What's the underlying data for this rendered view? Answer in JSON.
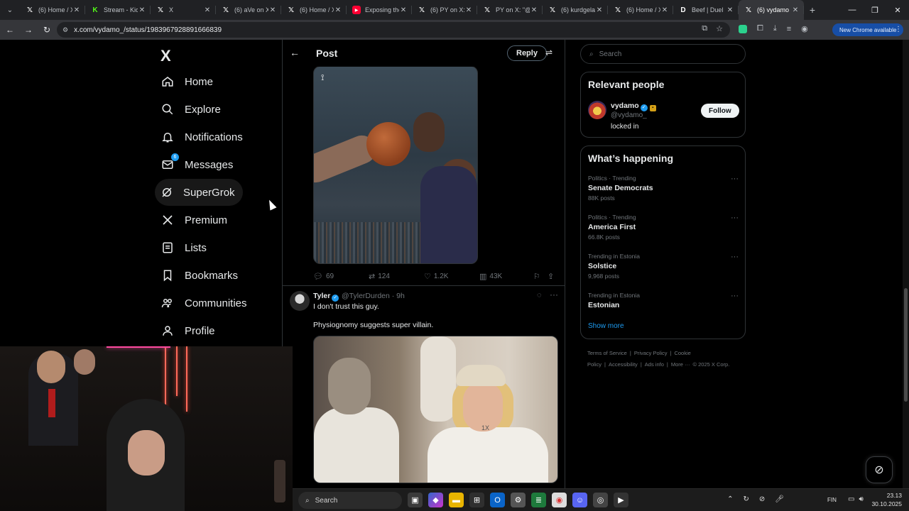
{
  "browser": {
    "tabs": [
      {
        "favicon": "x-icon",
        "title": "(6) Home / X",
        "active": false
      },
      {
        "favicon": "kick-icon",
        "title": "Stream - Kick",
        "active": false
      },
      {
        "favicon": "x-icon",
        "title": "X",
        "active": false
      },
      {
        "favicon": "x-icon",
        "title": "(6) aVe on X:",
        "active": false
      },
      {
        "favicon": "x-icon",
        "title": "(6) Home / X",
        "active": false
      },
      {
        "favicon": "youtube-icon",
        "title": "Exposing the",
        "active": false
      },
      {
        "favicon": "x-icon",
        "title": "(6) PY on X:",
        "active": false
      },
      {
        "favicon": "x-icon",
        "title": "PY on X: \"@",
        "active": false
      },
      {
        "favicon": "x-icon",
        "title": "(6) kurdgela",
        "active": false
      },
      {
        "favicon": "x-icon",
        "title": "(6) Home / X",
        "active": false
      },
      {
        "favicon": "d-icon",
        "title": "Beef | Duel",
        "active": false
      },
      {
        "favicon": "x-icon",
        "title": "(6) vydamo",
        "active": true
      }
    ],
    "url": "x.com/vydamo_/status/1983967928891666839",
    "new_chrome_label": "New Chrome available"
  },
  "nav": {
    "logo": "X",
    "items": [
      {
        "label": "Home",
        "icon": "home-icon"
      },
      {
        "label": "Explore",
        "icon": "search-icon"
      },
      {
        "label": "Notifications",
        "icon": "bell-icon"
      },
      {
        "label": "Messages",
        "icon": "mail-icon",
        "badge": "6"
      },
      {
        "label": "SuperGrok",
        "icon": "grok-icon"
      },
      {
        "label": "Premium",
        "icon": "x-premium-icon"
      },
      {
        "label": "Lists",
        "icon": "list-icon"
      },
      {
        "label": "Bookmarks",
        "icon": "bookmark-icon"
      },
      {
        "label": "Communities",
        "icon": "communities-icon"
      },
      {
        "label": "Profile",
        "icon": "profile-icon"
      }
    ]
  },
  "post": {
    "header_title": "Post",
    "reply_button": "Reply",
    "stats": {
      "replies": "69",
      "reposts": "124",
      "likes": "1.2K",
      "views": "43K"
    }
  },
  "reply": {
    "name": "Tyler",
    "handle": "@TylerDurden · 9h",
    "line1": "I don't trust this guy.",
    "line2": "Physiognomy suggests super villain."
  },
  "sidebar": {
    "search_placeholder": "Search",
    "relevant_title": "Relevant people",
    "person": {
      "name": "vydamo",
      "handle": "@vydamo_",
      "bio": "locked in",
      "follow_label": "Follow"
    },
    "happening_title": "What’s happening",
    "trends": [
      {
        "meta": "Politics · Trending",
        "name": "Senate Democrats",
        "posts": "88K posts"
      },
      {
        "meta": "Politics · Trending",
        "name": "America First",
        "posts": "66.8K posts"
      },
      {
        "meta": "Trending in Estonia",
        "name": "Solstice",
        "posts": "9,968 posts"
      },
      {
        "meta": "Trending in Estonia",
        "name": "Estonian",
        "posts": ""
      }
    ],
    "show_more": "Show more",
    "footer": [
      "Terms of Service",
      "|",
      "Privacy Policy",
      "|",
      "Cookie Policy",
      "|",
      "Accessibility",
      "|",
      "Ads info",
      "|",
      "More ···",
      "© 2025 X Corp."
    ]
  },
  "taskbar": {
    "search_label": "Search",
    "lang": "FIN",
    "time": "23.13",
    "date": "30.10.2025"
  }
}
